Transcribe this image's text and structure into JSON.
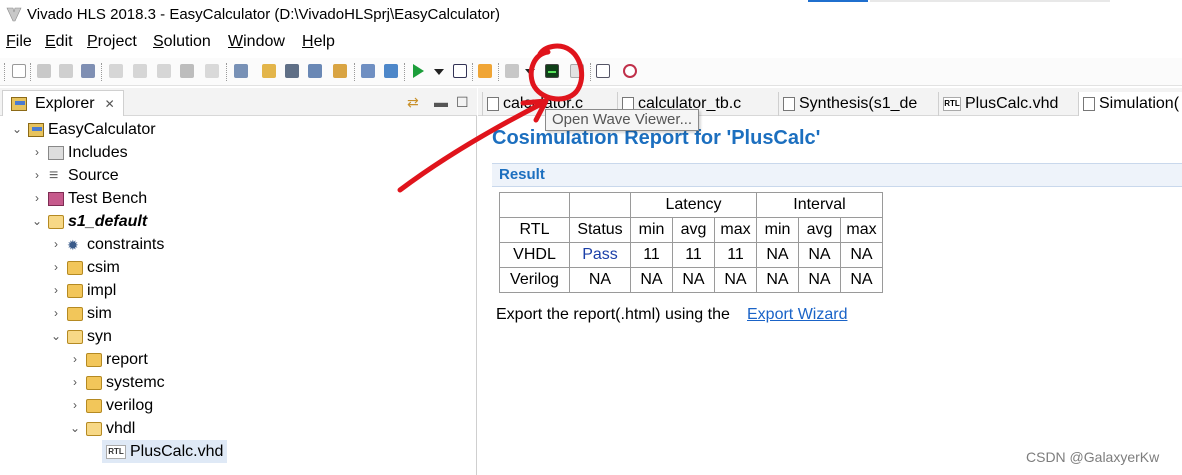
{
  "window": {
    "title": "Vivado HLS 2018.3 - EasyCalculator (D:\\VivadoHLSprj\\EasyCalculator)"
  },
  "menu": [
    "File",
    "Edit",
    "Project",
    "Solution",
    "Window",
    "Help"
  ],
  "toolbar": {
    "tooltip": "Open Wave Viewer..."
  },
  "explorer": {
    "title": "Explorer",
    "tree": [
      {
        "label": "EasyCalculator"
      },
      {
        "label": "Includes"
      },
      {
        "label": "Source"
      },
      {
        "label": "Test Bench"
      },
      {
        "label": "s1_default"
      },
      {
        "label": "constraints"
      },
      {
        "label": "csim"
      },
      {
        "label": "impl"
      },
      {
        "label": "sim"
      },
      {
        "label": "syn"
      },
      {
        "label": "report"
      },
      {
        "label": "systemc"
      },
      {
        "label": "verilog"
      },
      {
        "label": "vhdl"
      },
      {
        "label": "PlusCalc.vhd"
      }
    ]
  },
  "editor_tabs": [
    "calculator.c",
    "calculator_tb.c",
    "Synthesis(s1_de",
    "PlusCalc.vhd",
    "Simulation("
  ],
  "report": {
    "title": "Cosimulation Report for 'PlusCalc'",
    "section": "Result",
    "group_headers": [
      "Latency",
      "Interval"
    ],
    "columns": [
      "RTL",
      "Status",
      "min",
      "avg",
      "max",
      "min",
      "avg",
      "max"
    ],
    "rows": [
      [
        "VHDL",
        "Pass",
        "11",
        "11",
        "11",
        "NA",
        "NA",
        "NA"
      ],
      [
        "Verilog",
        "NA",
        "NA",
        "NA",
        "NA",
        "NA",
        "NA",
        "NA"
      ]
    ],
    "export_text": "Export the report(.html) using the",
    "export_link": "Export Wizard"
  },
  "watermark": "CSDN @GalaxyerKw",
  "colors": {
    "accent": "#1c6fbf",
    "annotation": "#e0141c",
    "pass": "#1b3fa8"
  }
}
